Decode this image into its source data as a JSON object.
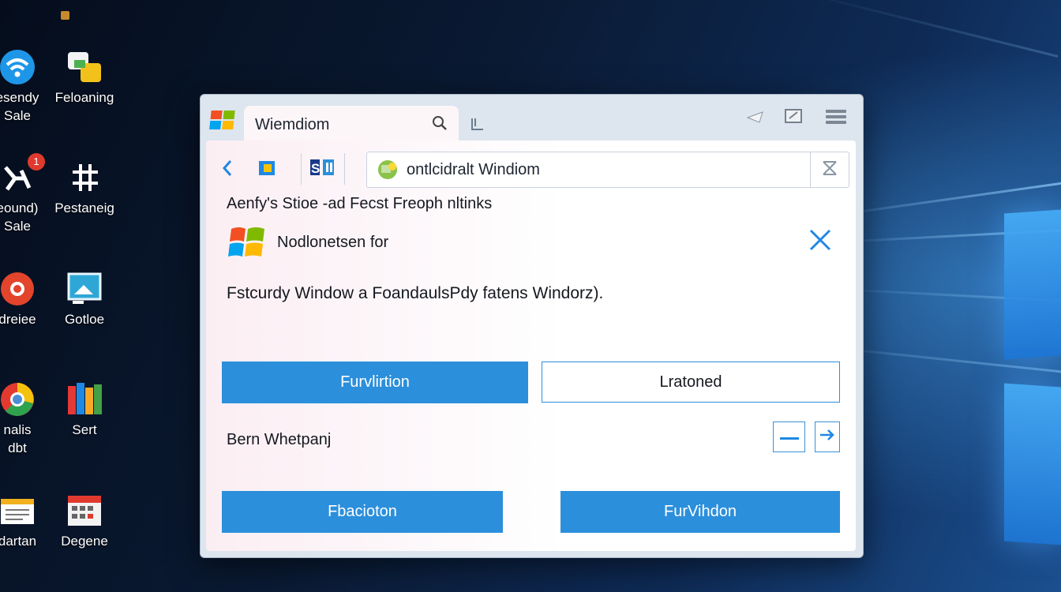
{
  "desktop": {
    "icons": [
      {
        "label1": "esendy",
        "label2": "Sale"
      },
      {
        "label1": "Feloaning",
        "label2": ""
      },
      {
        "label1": "eound)",
        "label2": "Sale"
      },
      {
        "label1": "Pestaneig",
        "label2": ""
      },
      {
        "label1": "dreiee",
        "label2": ""
      },
      {
        "label1": "Gotloe",
        "label2": ""
      },
      {
        "label1": "nalis",
        "label2": "dbt"
      },
      {
        "label1": "Sert",
        "label2": ""
      },
      {
        "label1": "dartan",
        "label2": ""
      },
      {
        "label1": "Degene",
        "label2": ""
      }
    ],
    "badge_count": "1"
  },
  "window": {
    "tab_title": "Wiemdiom",
    "address_text": "ontlcidralt Windiom",
    "heading": "Aenfy's Stioe -ad Fecst Freoph nltinks",
    "notice_title": "Nodlonetsen for",
    "description": "Fstcurdy Window a FoandaulsPdy fatens Windorz).",
    "button_primary_1": "Furvlirtion",
    "button_outline_1": "Lratoned",
    "row_label": "Bern Whetpanj",
    "button_primary_2": "Fbacioton",
    "button_primary_3": "FurVihdon"
  },
  "colors": {
    "accent": "#2b8fdc",
    "close_x": "#1e88e5"
  },
  "icons": [
    "search-icon",
    "back-chevron-icon",
    "close-icon",
    "minus-icon",
    "arrow-right-icon",
    "menu-icon",
    "windows-logo-icon"
  ]
}
